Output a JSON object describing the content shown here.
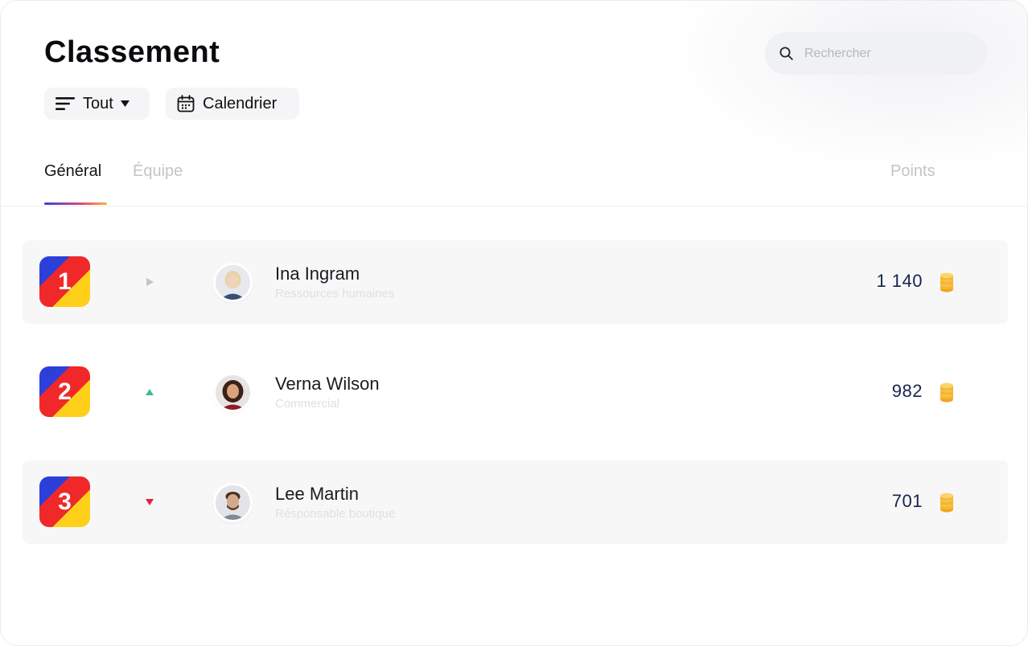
{
  "header": {
    "title": "Classement"
  },
  "filters": {
    "all_label": "Tout",
    "calendar_label": "Calendrier"
  },
  "search": {
    "placeholder": "Rechercher"
  },
  "tabs": [
    {
      "label": "Général",
      "active": true
    },
    {
      "label": "Équipe",
      "active": false
    }
  ],
  "columns": {
    "points": "Points"
  },
  "colors": {
    "accent_start": "#3b3fd6",
    "accent_end": "#f6b33a",
    "trend_up": "#3dbf8a",
    "trend_down": "#e3223a",
    "trend_same": "#c4c4c8"
  },
  "leaderboard": [
    {
      "rank": "1",
      "trend": "same",
      "trend_icon": "triangle-right-icon",
      "name": "Ina Ingram",
      "role": "Ressources humaines",
      "points": "1 140"
    },
    {
      "rank": "2",
      "trend": "up",
      "trend_icon": "triangle-up-icon",
      "name": "Verna Wilson",
      "role": "Commercial",
      "points": "982"
    },
    {
      "rank": "3",
      "trend": "down",
      "trend_icon": "triangle-down-icon",
      "name": "Lee Martin",
      "role": "Résponsable boutique",
      "points": "701"
    }
  ]
}
